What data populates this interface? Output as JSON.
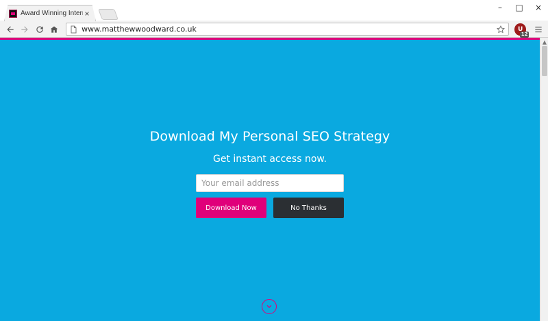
{
  "browser": {
    "tab": {
      "title": "Award Winning Internet M",
      "close_glyph": "×"
    },
    "window": {
      "minimize": "–",
      "maximize": "□",
      "close": "×"
    },
    "address": {
      "url": "www.matthewwoodward.co.uk"
    },
    "extension": {
      "label": "U",
      "badge": "12"
    }
  },
  "page": {
    "accent_colors": {
      "background": "#0aa9e0",
      "primary": "#e0007a",
      "secondary": "#2b2f33"
    },
    "hero": {
      "headline": "Download My Personal SEO Strategy",
      "subheadline": "Get instant access now."
    },
    "form": {
      "email_placeholder": "Your email address",
      "primary_button": "Download Now",
      "secondary_button": "No Thanks"
    },
    "icons": {
      "scroll_down": "chevron-down-icon"
    }
  }
}
